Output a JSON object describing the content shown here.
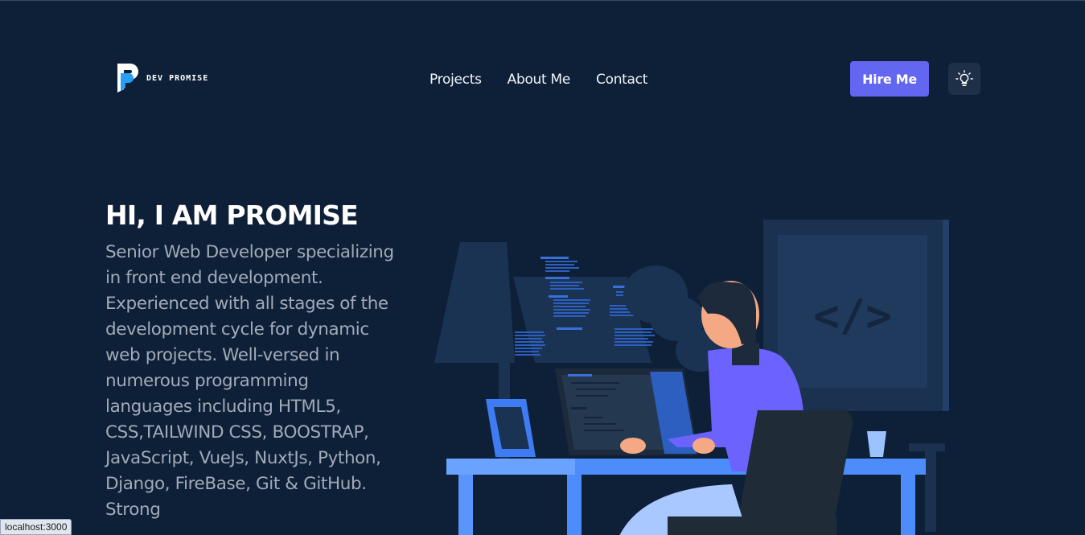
{
  "header": {
    "logo_text": "DEV PROMISE",
    "nav": [
      "Projects",
      "About Me",
      "Contact"
    ],
    "hire_label": "Hire Me"
  },
  "hero": {
    "title": "HI, I AM PROMISE",
    "description": "Senior Web Developer specializing in front end development. Experienced with all stages of the development cycle for dynamic web projects. Well-versed in numerous programming languages including HTML5, CSS,TAILWIND CSS, BOOSTRAP, JavaScript, VueJs, NuxtJs, Python, Django, FireBase, Git & GitHub. Strong"
  },
  "illustration": {
    "monitor_code_symbol": "</>"
  },
  "status_bar": {
    "url": "localhost:3000"
  },
  "colors": {
    "background": "#0e2038",
    "accent": "#6366f1",
    "text_muted": "#a1aab8"
  },
  "icons": {
    "theme_toggle": "lightbulb-icon",
    "logo": "p-logo-icon"
  }
}
